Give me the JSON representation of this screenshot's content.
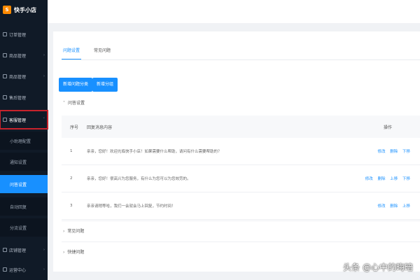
{
  "app": {
    "logo_text": "快手小店"
  },
  "sidebar": {
    "items": [
      {
        "label": "订单管理"
      },
      {
        "label": "商品管理"
      },
      {
        "label": "商品管理"
      },
      {
        "label": "售后管理"
      },
      {
        "label": "客服管理"
      },
      {
        "label": "小助理配置"
      },
      {
        "label": "通知设置"
      },
      {
        "label": "问答设置"
      },
      {
        "label": "自动回复"
      },
      {
        "label": "分流设置"
      },
      {
        "label": "店铺管理"
      },
      {
        "label": "运营中心"
      }
    ]
  },
  "tabs": [
    {
      "label": "问题设置"
    },
    {
      "label": "常见问题"
    }
  ],
  "buttons": {
    "add_question": "新增问题分类",
    "add_category": "新增分组"
  },
  "sections": {
    "first": "问答设置",
    "second": "常见问题",
    "third": "快捷问题"
  },
  "table": {
    "headers": {
      "no": "序号",
      "content": "回复消息内容",
      "op": "操作"
    },
    "rows": [
      {
        "no": "1",
        "content": "亲亲，您好！欢迎光临快手小店！如果需要什么帮助，请问有什么需要帮助的？",
        "ops": [
          "修改",
          "删除",
          "下移"
        ]
      },
      {
        "no": "2",
        "content": "亲亲，您好！很高兴为您服务，有什么为您可以为您效劳的。",
        "ops": [
          "修改",
          "删除",
          "上移",
          "下移"
        ]
      },
      {
        "no": "3",
        "content": "亲亲请稍等哈，我们一会就会马上回复，节约时间！",
        "ops": [
          "修改",
          "删除",
          "上移"
        ]
      }
    ]
  },
  "watermark": "头条 @心中的晦暗"
}
